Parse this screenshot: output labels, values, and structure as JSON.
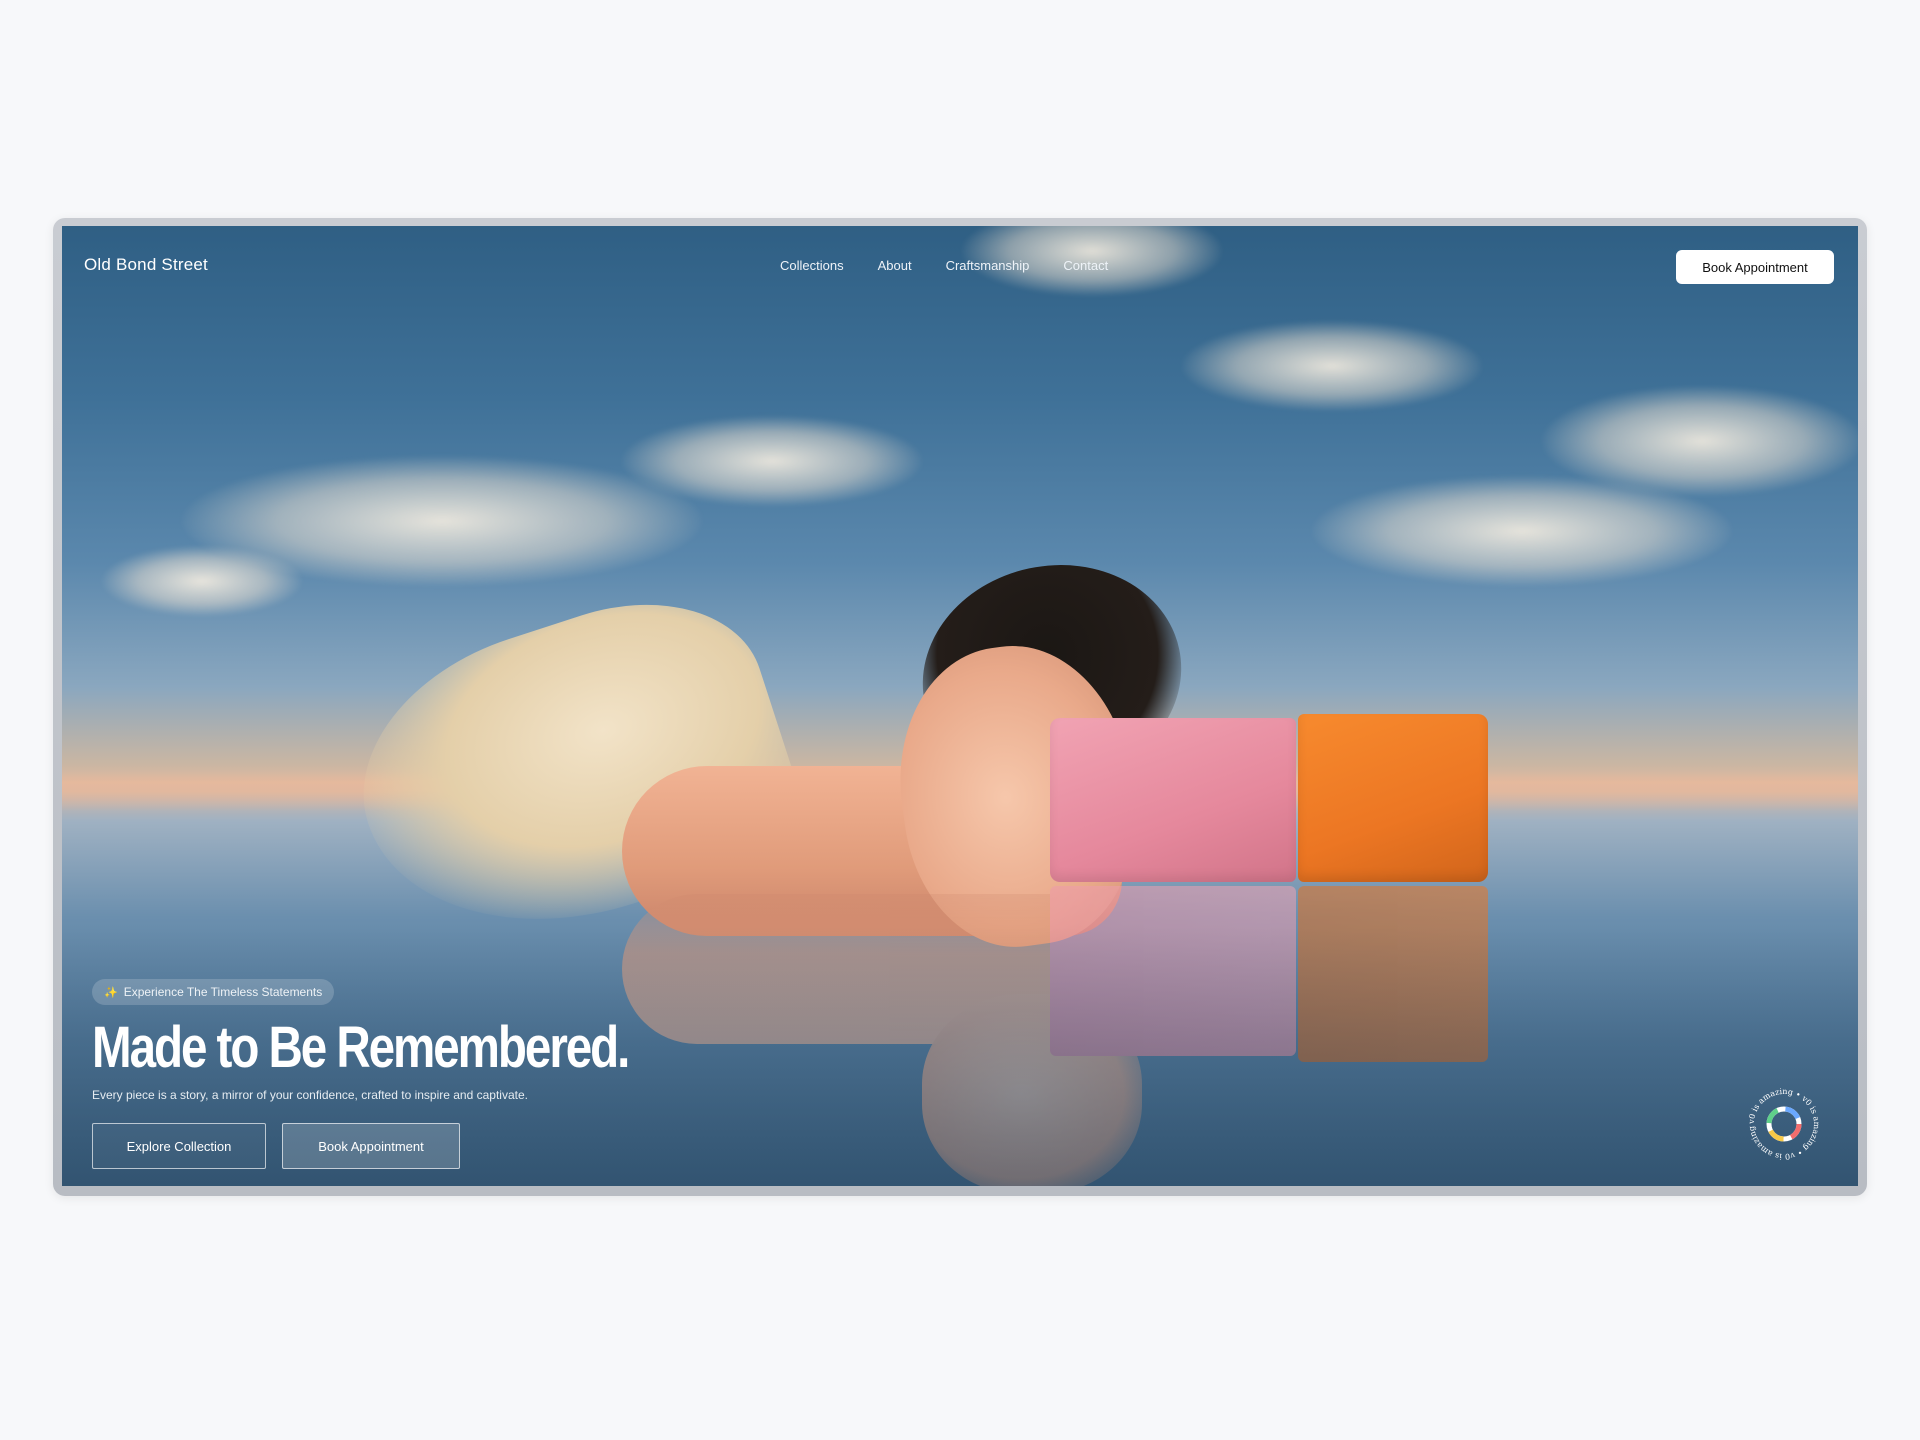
{
  "brand": {
    "name": "Old Bond Street"
  },
  "nav": {
    "items": [
      {
        "label": "Collections"
      },
      {
        "label": "About"
      },
      {
        "label": "Craftsmanship"
      },
      {
        "label": "Contact"
      }
    ],
    "cta_label": "Book Appointment"
  },
  "hero": {
    "tag": "Experience The Timeless Statements",
    "tag_icon": "sparkle-icon",
    "headline": "Made to Be Remembered.",
    "subcopy": "Every piece is a story, a mirror of your confidence, crafted to inspire and captivate.",
    "primary_button": "Explore Collection",
    "secondary_button": "Book Appointment"
  },
  "badge": {
    "ring_text": "v0 is amazing • v0 is amazing • v0 is amazing •",
    "icon": "rainbow-ring-icon"
  },
  "colors": {
    "background": "#f7f8fa",
    "sky": "#3f7198",
    "bag_pink": "#e5889c",
    "bag_orange": "#ec7623",
    "cta_bg": "#ffffff"
  }
}
